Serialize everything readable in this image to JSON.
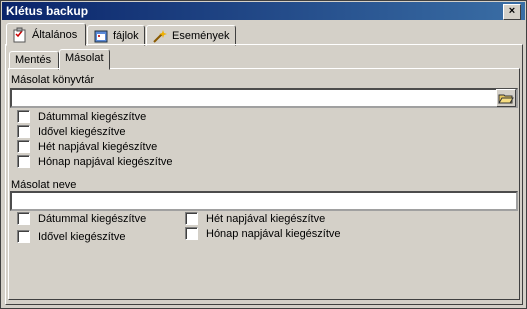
{
  "window": {
    "title": "Klétus backup",
    "close_glyph": "×"
  },
  "tabs": [
    {
      "label": "Általános",
      "icon": "checklist-icon",
      "active": true
    },
    {
      "label": "fájlok",
      "icon": "folder-calendar-icon",
      "active": false
    },
    {
      "label": "Események",
      "icon": "magic-events-icon",
      "active": false
    }
  ],
  "subtabs": [
    {
      "label": "Mentés",
      "active": false
    },
    {
      "label": "Másolat",
      "active": true
    }
  ],
  "copy_dir": {
    "label": "Másolat könyvtár",
    "value": "",
    "options": [
      "Dátummal kiegészítve",
      "Idővel kiegészítve",
      "Hét napjával kiegészítve",
      "Hónap napjával kiegészítve"
    ]
  },
  "copy_name": {
    "label": "Másolat neve",
    "value": "",
    "options": [
      "Dátummal kiegészítve",
      "Idővel kiegészítve",
      "Hét napjával kiegészítve",
      "Hónap napjával kiegészítve"
    ]
  }
}
